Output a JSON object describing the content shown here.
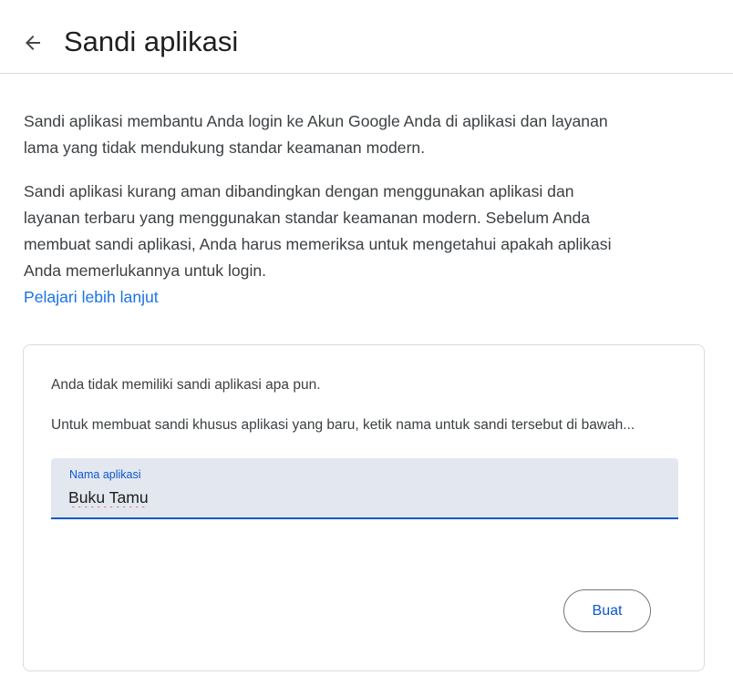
{
  "header": {
    "back_icon": "arrow-left-icon",
    "title": "Sandi aplikasi"
  },
  "intro": {
    "paragraph1": "Sandi aplikasi membantu Anda login ke Akun Google Anda di aplikasi dan layanan lama yang tidak mendukung standar keamanan modern.",
    "paragraph2": "Sandi aplikasi kurang aman dibandingkan dengan menggunakan aplikasi dan layanan terbaru yang menggunakan standar keamanan modern. Sebelum Anda membuat sandi aplikasi, Anda harus memeriksa untuk mengetahui apakah aplikasi Anda memerlukannya untuk login.",
    "learn_more": "Pelajari lebih lanjut"
  },
  "card": {
    "empty_message": "Anda tidak memiliki sandi aplikasi apa pun.",
    "instruction": "Untuk membuat sandi khusus aplikasi yang baru, ketik nama untuk sandi tersebut di bawah...",
    "field": {
      "label": "Nama aplikasi",
      "value": "Buku Tamu"
    },
    "create_label": "Buat"
  },
  "colors": {
    "accent": "#0b57d0",
    "link": "#1a73e8",
    "field_bg": "#e3e7ef",
    "border": "#dadce0"
  }
}
